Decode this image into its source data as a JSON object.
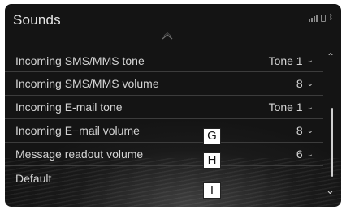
{
  "header": {
    "title": "Sounds"
  },
  "icons": {
    "signal": "signal-strength-icon",
    "phone": "phone-icon",
    "bluetooth": "bluetooth-icon",
    "scroll_up": "chevron-up-icon",
    "scroll_down": "chevron-down-icon"
  },
  "rows": [
    {
      "label": "Incoming SMS/MMS tone",
      "value": "Tone 1"
    },
    {
      "label": "Incoming SMS/MMS volume",
      "value": "8"
    },
    {
      "label": "Incoming E-mail tone",
      "value": "Tone 1"
    },
    {
      "label": "Incoming E−mail volume",
      "value": "8"
    },
    {
      "label": "Message readout volume",
      "value": "6"
    },
    {
      "label": "Default",
      "value": ""
    }
  ],
  "glyphs": {
    "chevron_down": "⌄",
    "chevron_up": "⌃",
    "bluetooth": "ᛒ"
  },
  "markers": [
    "G",
    "H",
    "I"
  ],
  "colors": {
    "screen_bg": "#141414",
    "text": "#d4d4d4",
    "divider": "#3c3c3c"
  }
}
